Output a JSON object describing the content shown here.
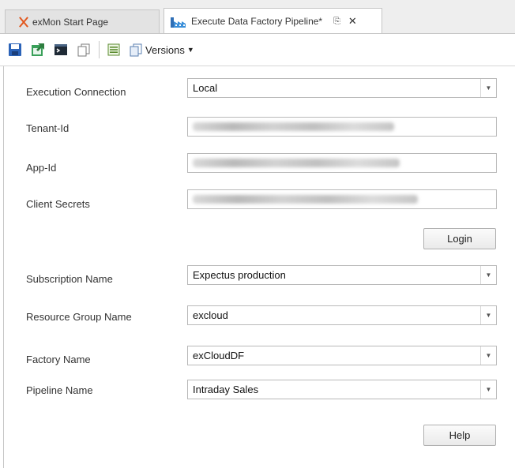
{
  "tabs": [
    {
      "label": "exMon Start Page",
      "icon": "exmon-x-icon"
    },
    {
      "label": "Execute Data Factory Pipeline*",
      "icon": "data-factory-icon"
    }
  ],
  "toolbar": {
    "versions_label": "Versions",
    "icons": [
      "save-icon",
      "export-icon",
      "console-icon",
      "copy-icon",
      "list-icon",
      "versions-icon"
    ]
  },
  "form": {
    "execution_connection": {
      "label": "Execution Connection",
      "value": "Local"
    },
    "tenant_id": {
      "label": "Tenant-Id"
    },
    "app_id": {
      "label": "App-Id"
    },
    "client_secrets": {
      "label": "Client Secrets"
    },
    "login_label": "Login",
    "subscription_name": {
      "label": "Subscription Name",
      "value": "Expectus production"
    },
    "resource_group_name": {
      "label": "Resource Group Name",
      "value": "excloud"
    },
    "factory_name": {
      "label": "Factory Name",
      "value": "exCloudDF"
    },
    "pipeline_name": {
      "label": "Pipeline Name",
      "value": "Intraday Sales"
    },
    "help_label": "Help"
  },
  "colors": {
    "accent_orange": "#e2581f",
    "save_blue": "#2b63b8",
    "export_green": "#3aa05a"
  }
}
